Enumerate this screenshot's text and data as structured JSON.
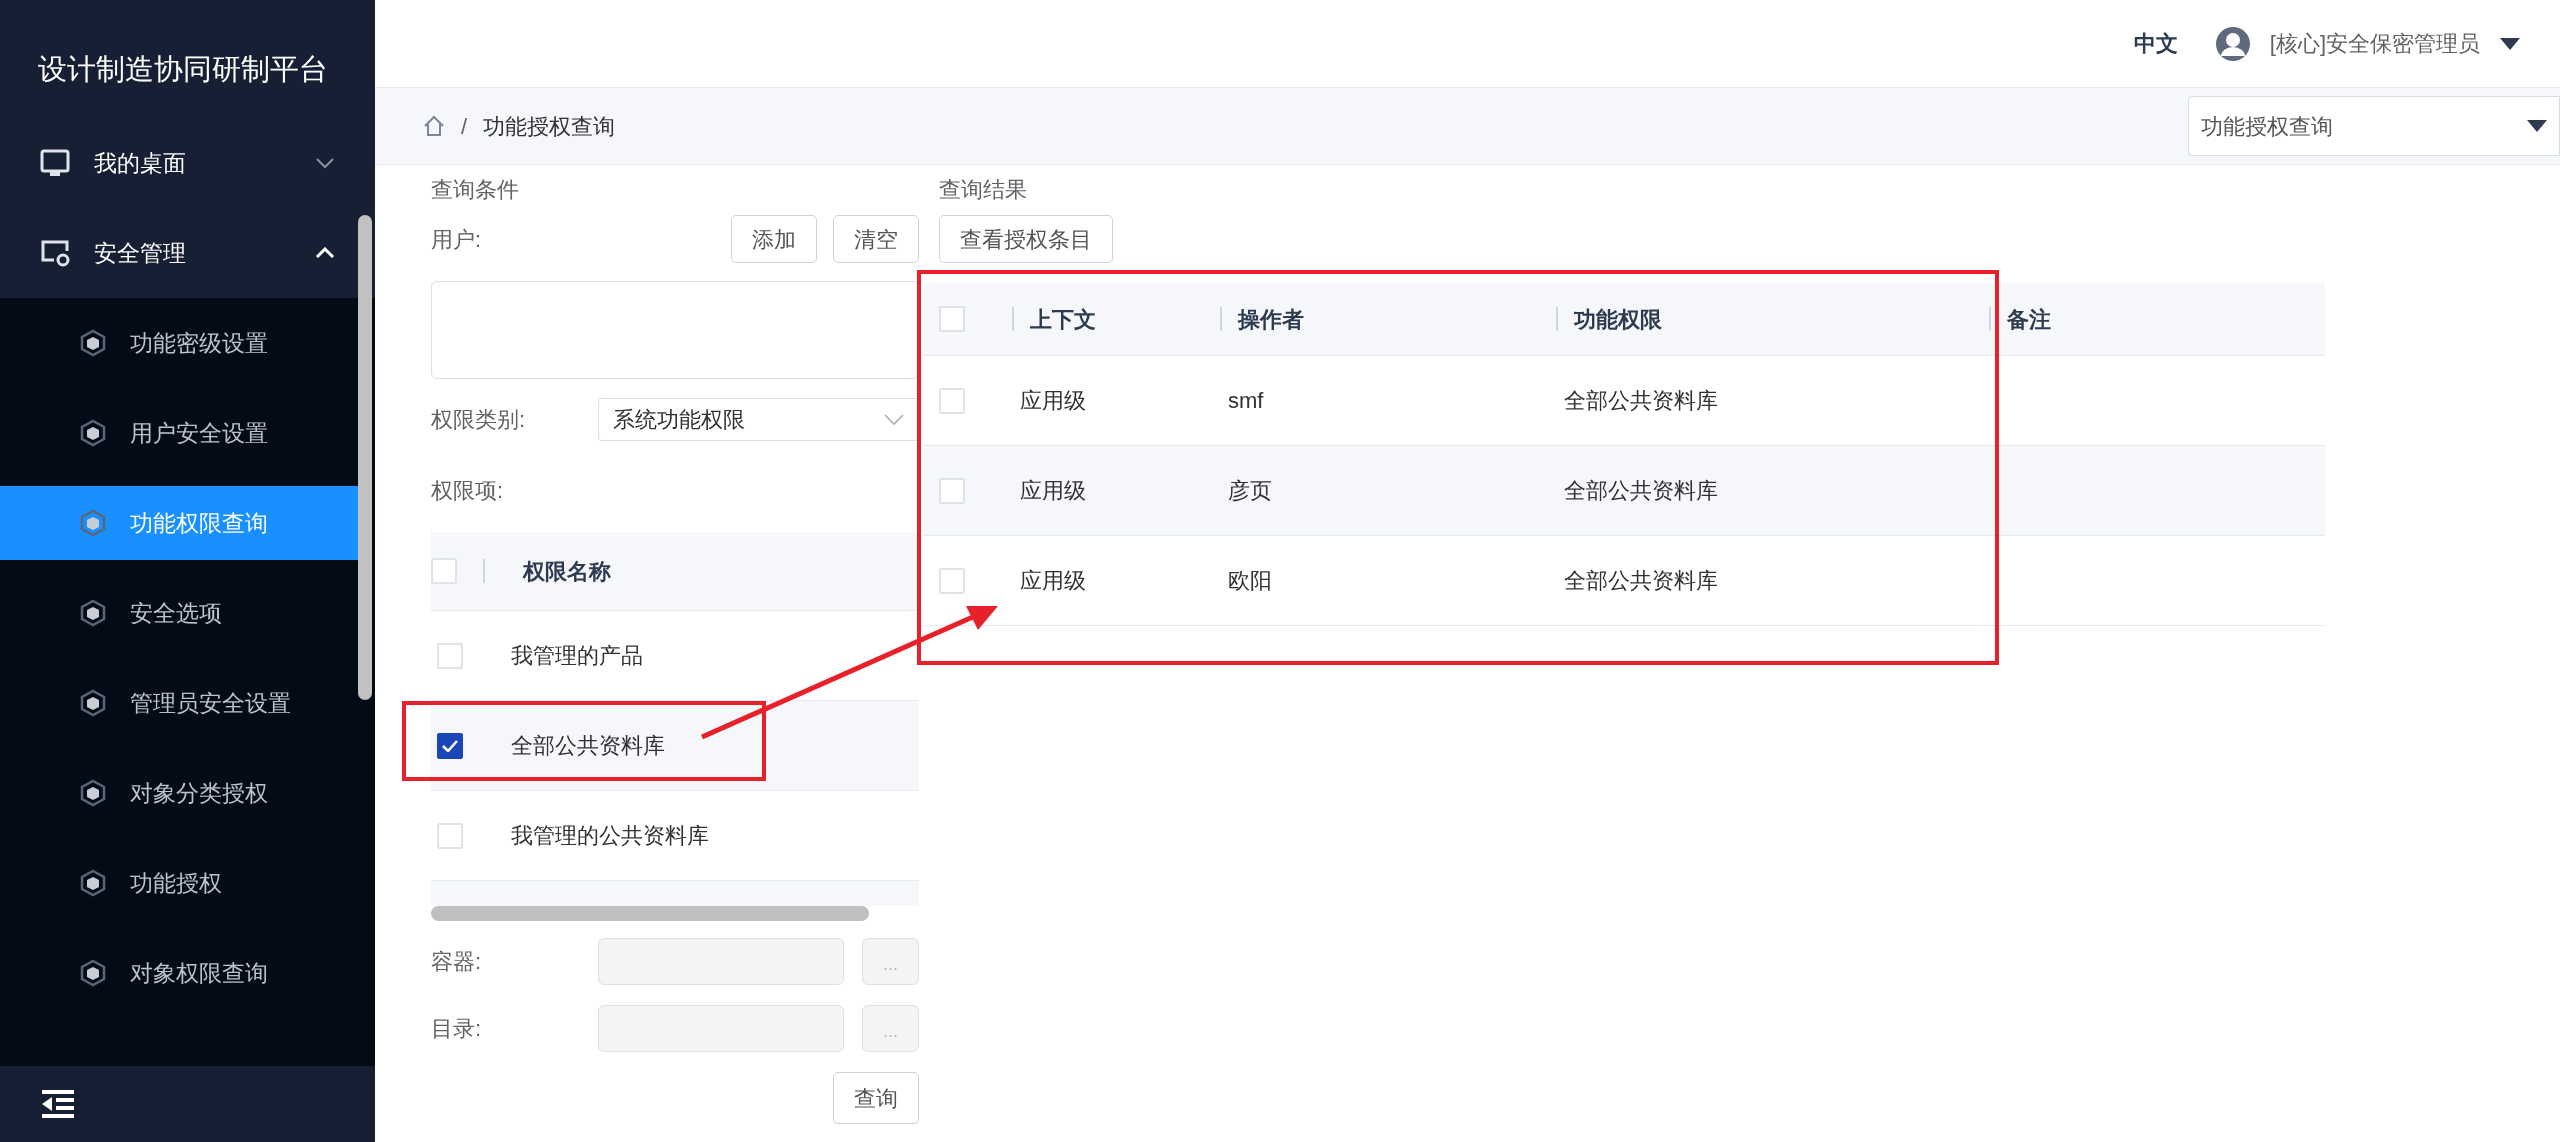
{
  "sidebar": {
    "title": "设计制造协同研制平台",
    "menu": [
      {
        "label": "我的桌面",
        "expanded": false
      },
      {
        "label": "安全管理",
        "expanded": true,
        "children": [
          {
            "label": "功能密级设置",
            "selected": false
          },
          {
            "label": "用户安全设置",
            "selected": false
          },
          {
            "label": "功能权限查询",
            "selected": true
          },
          {
            "label": "安全选项",
            "selected": false
          },
          {
            "label": "管理员安全设置",
            "selected": false
          },
          {
            "label": "对象分类授权",
            "selected": false
          },
          {
            "label": "功能授权",
            "selected": false
          },
          {
            "label": "对象权限查询",
            "selected": false
          }
        ]
      }
    ]
  },
  "header": {
    "language": {
      "label": "中文",
      "selected": true
    },
    "user": "[核心]安全保密管理员"
  },
  "breadcrumb": {
    "separator": "/",
    "items": [
      "功能授权查询"
    ],
    "page_select": "功能授权查询"
  },
  "query": {
    "title": "查询条件",
    "user_label": "用户:",
    "buttons": [
      "添加",
      "清空"
    ],
    "type_label": "权限类别:",
    "type_value": "系统功能权限",
    "items_label": "权限项:",
    "items_table": {
      "column": "权限名称",
      "all_checked": false,
      "rows": [
        {
          "name": "我管理的产品",
          "checked": false
        },
        {
          "name": "全部公共资料库",
          "checked": true
        },
        {
          "name": "我管理的公共资料库",
          "checked": false
        }
      ]
    },
    "fields": [
      {
        "label": "容器:",
        "browse": "...",
        "disabled": true
      },
      {
        "label": "目录:",
        "browse": "...",
        "disabled": true
      }
    ],
    "submit": "查询"
  },
  "results": {
    "title": "查询结果",
    "view_button": "查看授权条目",
    "table": {
      "all_checked": false,
      "columns": [
        "上下文",
        "操作者",
        "功能权限",
        "备注"
      ],
      "rows": [
        {
          "checked": false,
          "cells": [
            "应用级",
            "smf",
            "全部公共资料库"
          ]
        },
        {
          "checked": false,
          "cells": [
            "应用级",
            "彦页",
            "全部公共资料库"
          ]
        },
        {
          "checked": false,
          "cells": [
            "应用级",
            "欧阳",
            "全部公共资料库"
          ]
        }
      ]
    }
  }
}
